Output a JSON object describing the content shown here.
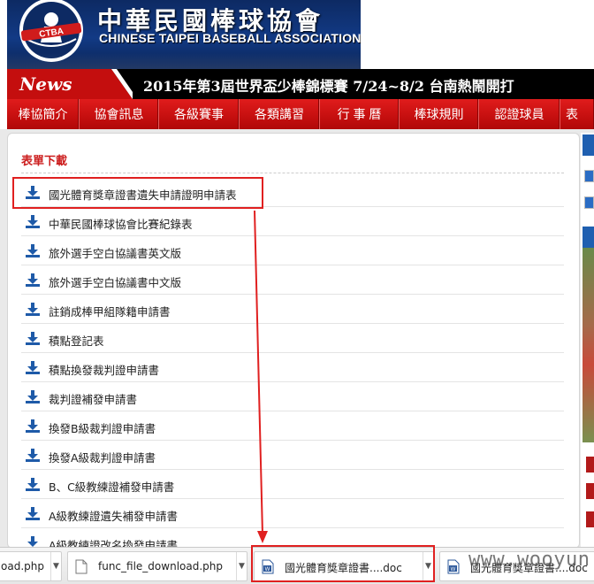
{
  "header": {
    "title_zh": "中華民國棒球協會",
    "title_en": "CHINESE TAIPEI BASEBALL ASSOCIATION",
    "logo_text": "CTBA"
  },
  "newsbar": {
    "tag": "News",
    "headline": "2015年第3屆世界盃少棒錦標賽 7/24~8/2 台南熱鬧開打"
  },
  "nav": {
    "items": [
      {
        "label": "棒協簡介"
      },
      {
        "label": "協會訊息"
      },
      {
        "label": "各級賽事"
      },
      {
        "label": "各類講習"
      },
      {
        "label": "行 事 曆"
      },
      {
        "label": "棒球規則"
      },
      {
        "label": "認證球員"
      },
      {
        "label": "表"
      }
    ]
  },
  "panel": {
    "title": "表單下載",
    "files": [
      {
        "label": "國光體育獎章證書遺失申請證明申請表"
      },
      {
        "label": "中華民國棒球協會比賽紀錄表"
      },
      {
        "label": "旅外選手空白協議書英文版"
      },
      {
        "label": "旅外選手空白協議書中文版"
      },
      {
        "label": "註銷成棒甲組隊籍申請書"
      },
      {
        "label": "積點登記表"
      },
      {
        "label": "積點換發裁判證申請書"
      },
      {
        "label": "裁判證補發申請書"
      },
      {
        "label": "換發B級裁判證申請書"
      },
      {
        "label": "換發A級裁判證申請書"
      },
      {
        "label": "B、C級教練證補發申請書"
      },
      {
        "label": "A級教練證遺失補發申請書"
      },
      {
        "label": "A級教練證改名換發申請書"
      }
    ]
  },
  "downloads": {
    "items": [
      {
        "name": "oad.php"
      },
      {
        "name": "func_file_download.php"
      },
      {
        "name": "國光體育獎章證書....doc"
      },
      {
        "name": "國光體育獎章證書....doc"
      }
    ]
  },
  "watermark": "www.wooyun.org",
  "colors": {
    "nav_red": "#c50f0f",
    "title_red": "#cc1f1f",
    "banner_blue": "#123a85",
    "highlight_red": "#e02020",
    "download_icon_blue": "#1e5aa8"
  }
}
